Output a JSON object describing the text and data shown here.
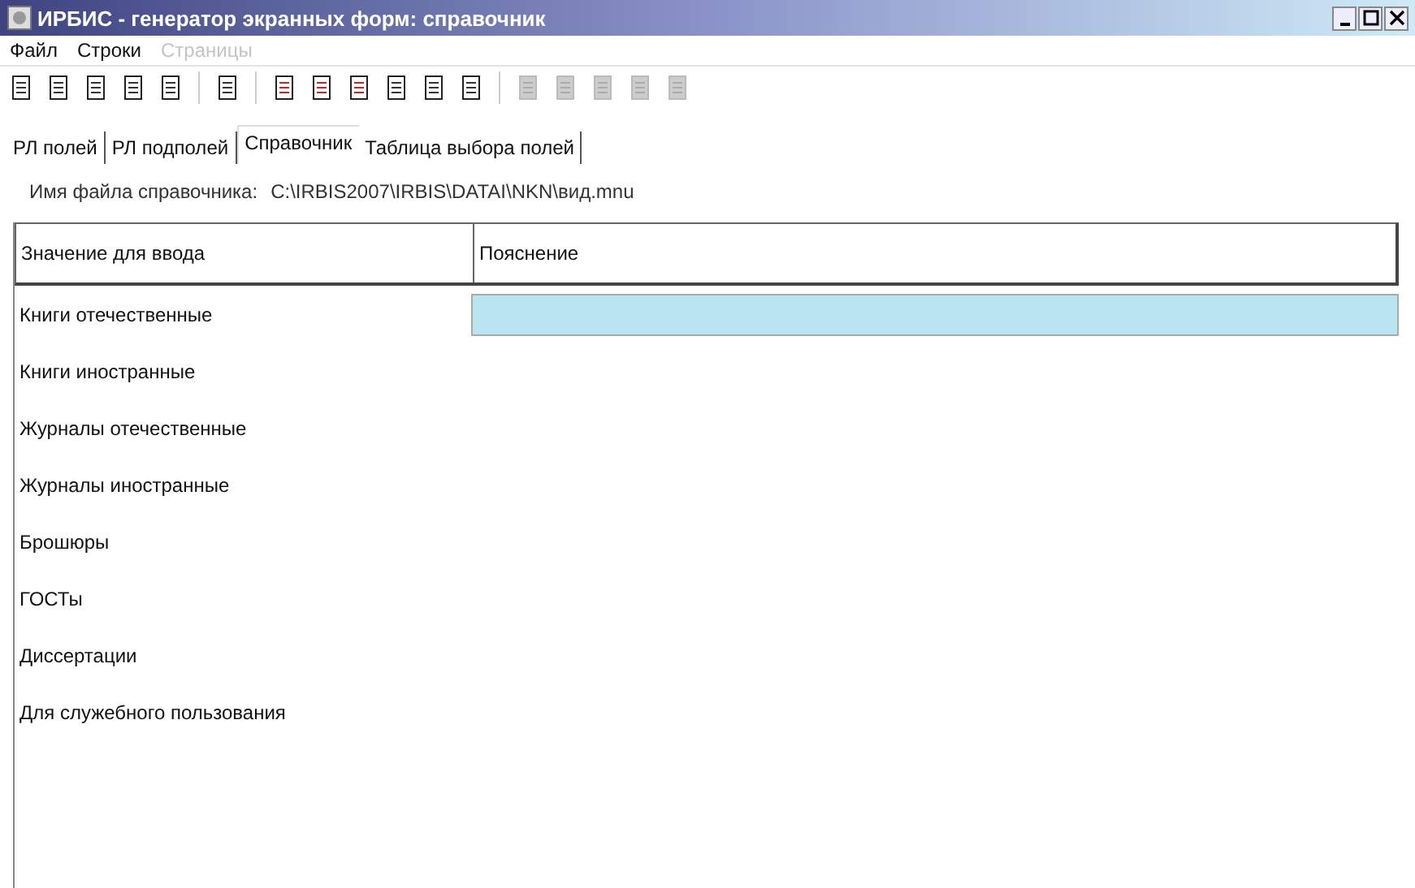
{
  "window": {
    "title": "ИРБИС - генератор экранных форм: справочник"
  },
  "menu": [
    {
      "label": "Файл",
      "disabled": false
    },
    {
      "label": "Строки",
      "disabled": false
    },
    {
      "label": "Страницы",
      "disabled": true
    }
  ],
  "toolbar": [
    {
      "disabled": false
    },
    {
      "disabled": false
    },
    {
      "disabled": false
    },
    {
      "disabled": false
    },
    {
      "disabled": false
    },
    {
      "disabled": false
    },
    {
      "disabled": false
    },
    {
      "disabled": false
    },
    {
      "disabled": false
    },
    {
      "disabled": false
    },
    {
      "disabled": false
    },
    {
      "disabled": false
    },
    {
      "disabled": true
    },
    {
      "disabled": true
    },
    {
      "disabled": true
    },
    {
      "disabled": true
    },
    {
      "disabled": true
    }
  ],
  "tabs": [
    {
      "label": "РЛ полей",
      "selected": false
    },
    {
      "label": "РЛ подполей",
      "selected": false
    },
    {
      "label": "Справочник",
      "selected": true
    },
    {
      "label": "Таблица выбора полей",
      "selected": false
    }
  ],
  "file": {
    "label": "Имя файла справочника:",
    "path": "C:\\IRBIS2007\\IRBIS\\DATAI\\NKN\\вид.mnu"
  },
  "table": {
    "columns": [
      "Значение для ввода",
      "Пояснение"
    ],
    "rows": [
      {
        "value": "Книги отечественные",
        "selected": true
      },
      {
        "value": "Книги иностранные",
        "selected": false
      },
      {
        "value": "Журналы отечественные",
        "selected": false
      },
      {
        "value": "Журналы иностранные",
        "selected": false
      },
      {
        "value": "Брошюры",
        "selected": false
      },
      {
        "value": "ГОСТы",
        "selected": false
      },
      {
        "value": "Диссертации",
        "selected": false
      },
      {
        "value": "Для служебного пользования",
        "selected": false
      }
    ]
  }
}
